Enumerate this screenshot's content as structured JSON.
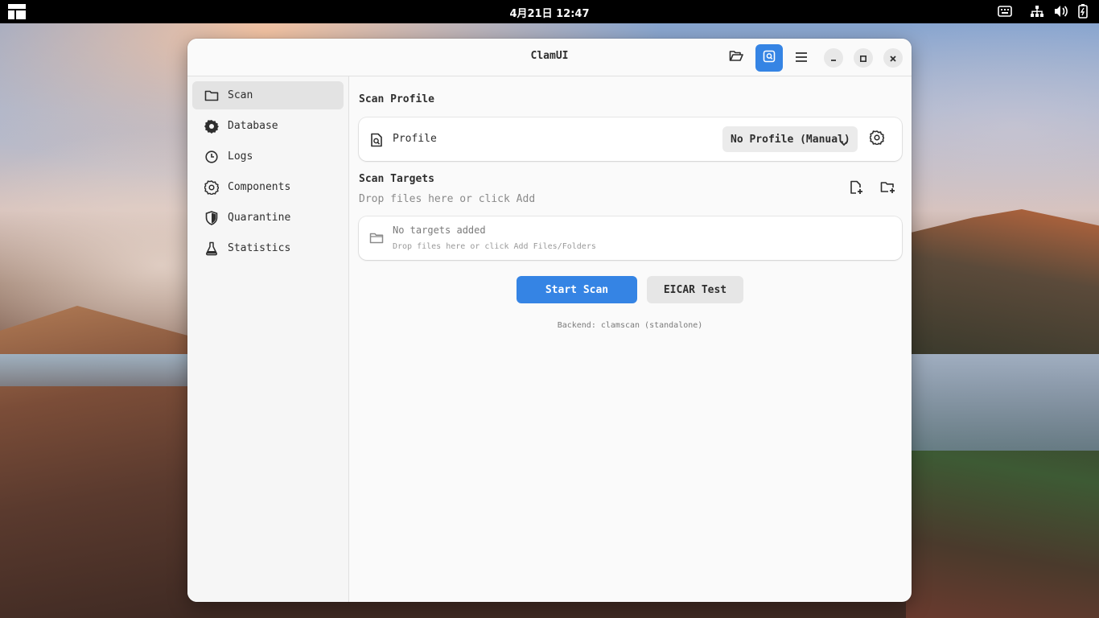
{
  "topbar": {
    "clock": "4月21日 12:47",
    "icons": [
      "activities-icon",
      "keyboard-icon",
      "network-icon",
      "volume-icon",
      "battery-icon"
    ]
  },
  "window": {
    "title": "ClamUI",
    "accent": "#3584e4",
    "header_buttons": [
      "folder-open-icon",
      "scan-view-icon",
      "hamburger-menu-icon",
      "minimize-icon",
      "maximize-icon",
      "close-icon"
    ]
  },
  "sidebar": {
    "items": [
      {
        "label": "Scan",
        "icon": "folder-icon",
        "selected": true
      },
      {
        "label": "Database",
        "icon": "database-gear-icon",
        "selected": false
      },
      {
        "label": "Logs",
        "icon": "clock-icon",
        "selected": false
      },
      {
        "label": "Components",
        "icon": "gear-icon",
        "selected": false
      },
      {
        "label": "Quarantine",
        "icon": "shield-icon",
        "selected": false
      },
      {
        "label": "Statistics",
        "icon": "flask-icon",
        "selected": false
      }
    ]
  },
  "scan_profile": {
    "section_title": "Scan Profile",
    "row_label": "Profile",
    "selected_profile": "No Profile (Manual)"
  },
  "scan_targets": {
    "section_title": "Scan Targets",
    "subtitle": "Drop files here or click Add",
    "empty_title": "No targets added",
    "empty_hint": "Drop files here or click Add Files/Folders"
  },
  "actions": {
    "start_scan": "Start Scan",
    "eicar_test": "EICAR Test"
  },
  "backend_status": "Backend: clamscan (standalone)"
}
